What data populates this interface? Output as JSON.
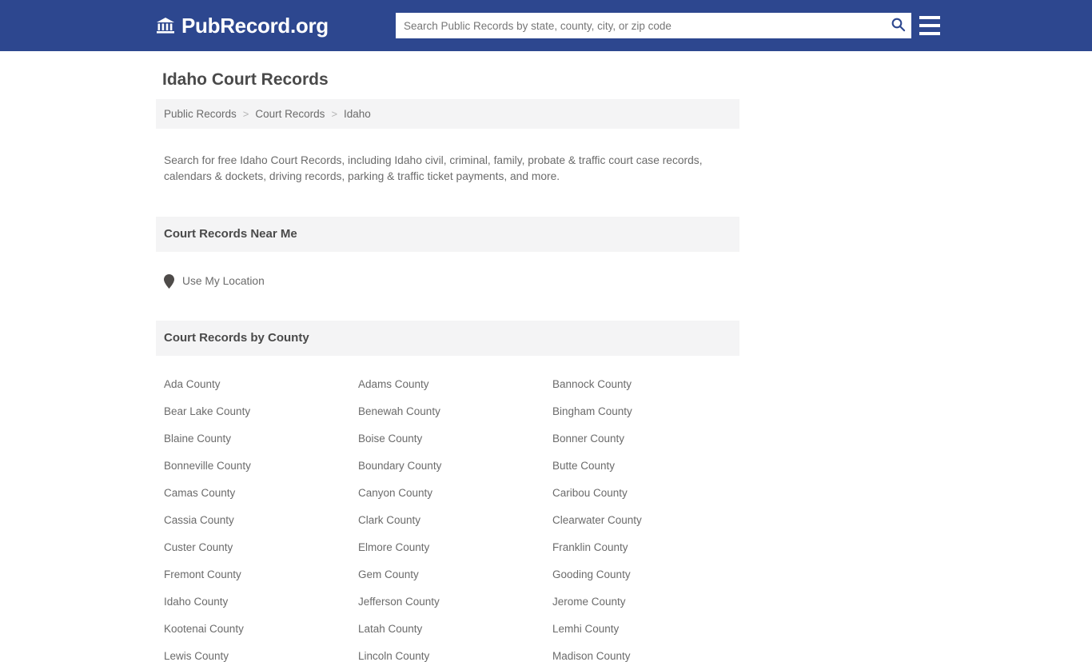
{
  "header": {
    "brand_icon": "bank-building-icon",
    "brand_text": "PubRecord.org",
    "search": {
      "placeholder": "Search Public Records by state, county, city, or zip code",
      "value": "",
      "search_icon": "search-icon"
    },
    "menu_icon": "hamburger-menu-icon",
    "background_color": "#2d478f"
  },
  "main": {
    "page_title": "Idaho Court Records",
    "breadcrumb": {
      "items": [
        {
          "label": "Public Records",
          "current": false
        },
        {
          "label": "Court Records",
          "current": false
        },
        {
          "label": "Idaho",
          "current": true
        }
      ],
      "separator": ">"
    },
    "intro": "Search for free Idaho Court Records, including Idaho civil, criminal, family, probate & traffic court case records, calendars & dockets, driving records, parking & traffic ticket payments, and more.",
    "near_me": {
      "section_title": "Court Records Near Me",
      "pin_icon": "map-marker-icon",
      "link_label": "Use My Location"
    },
    "by_county": {
      "section_title": "Court Records by County",
      "counties": [
        "Ada County",
        "Adams County",
        "Bannock County",
        "Bear Lake County",
        "Benewah County",
        "Bingham County",
        "Blaine County",
        "Boise County",
        "Bonner County",
        "Bonneville County",
        "Boundary County",
        "Butte County",
        "Camas County",
        "Canyon County",
        "Caribou County",
        "Cassia County",
        "Clark County",
        "Clearwater County",
        "Custer County",
        "Elmore County",
        "Franklin County",
        "Fremont County",
        "Gem County",
        "Gooding County",
        "Idaho County",
        "Jefferson County",
        "Jerome County",
        "Kootenai County",
        "Latah County",
        "Lemhi County",
        "Lewis County",
        "Lincoln County",
        "Madison County"
      ]
    }
  },
  "colors": {
    "brand_blue": "#2d478f",
    "band_gray": "#f4f4f5",
    "text_gray": "#6b6b6b",
    "heading_gray": "#4a4a4a"
  }
}
